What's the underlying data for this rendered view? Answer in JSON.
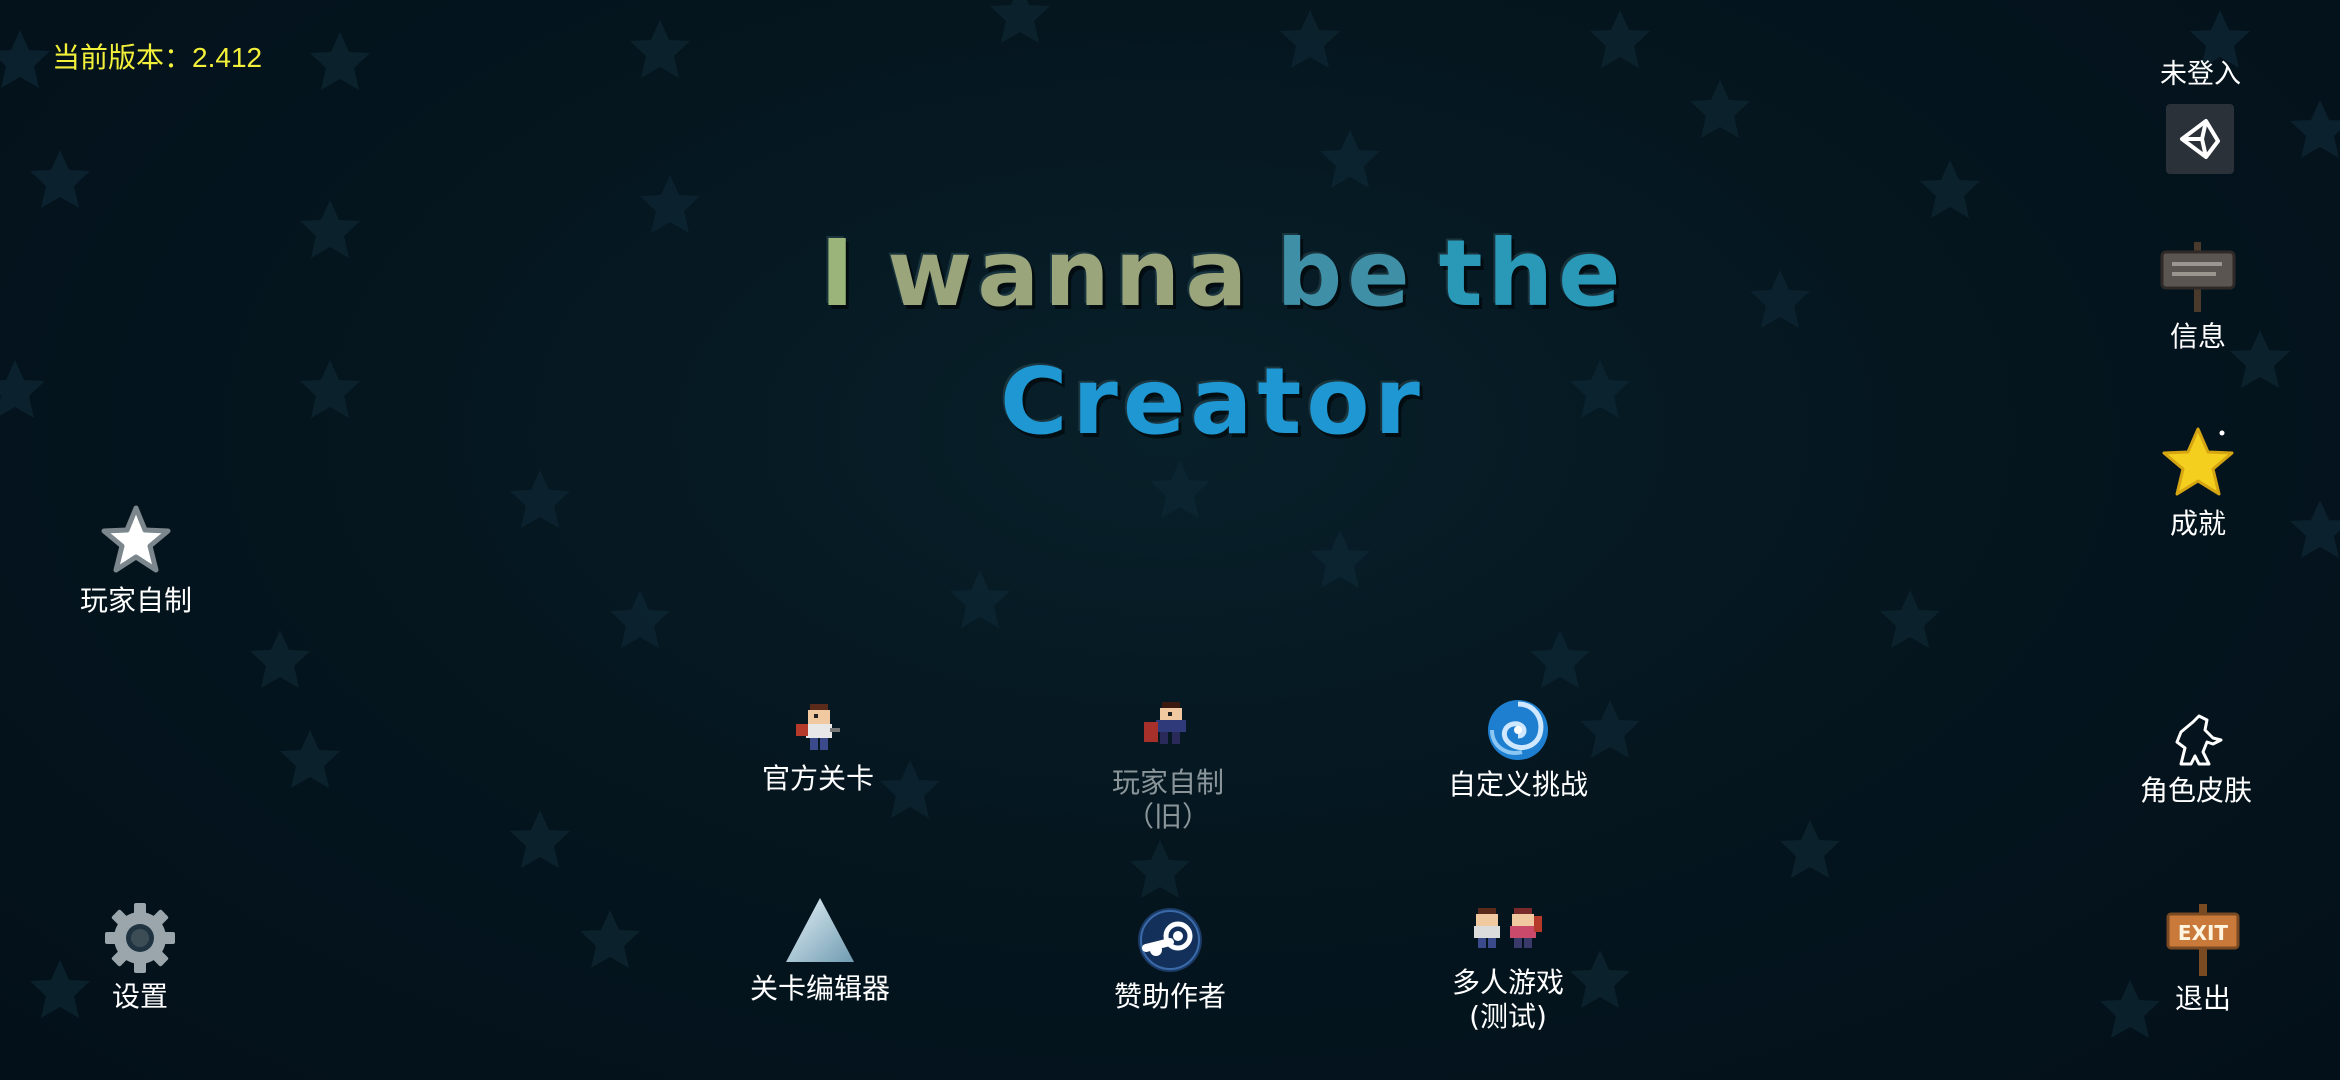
{
  "version": {
    "label": "当前版本：",
    "value": "2.412"
  },
  "title": {
    "line1_words": [
      "I",
      "wanna",
      "be",
      "the"
    ],
    "line2": "Creator"
  },
  "account": {
    "status": "未登入",
    "icon": "unity-icon"
  },
  "right_menu": {
    "info": "信息",
    "achievements": "成就",
    "skins": "角色皮肤",
    "exit": "退出",
    "exit_sign_text": "EXIT"
  },
  "left_menu": {
    "player_made": "玩家自制",
    "settings": "设置"
  },
  "center_menu": {
    "official_levels": "官方关卡",
    "player_made_old_line1": "玩家自制",
    "player_made_old_line2": "（旧）",
    "custom_challenge": "自定义挑战",
    "level_editor": "关卡编辑器",
    "sponsor": "赞助作者",
    "multiplayer_line1": "多人游戏",
    "multiplayer_line2": "(测试)"
  },
  "colors": {
    "version": "#f3f03a",
    "background": "#05161f",
    "dim_label": "#8a959a"
  }
}
